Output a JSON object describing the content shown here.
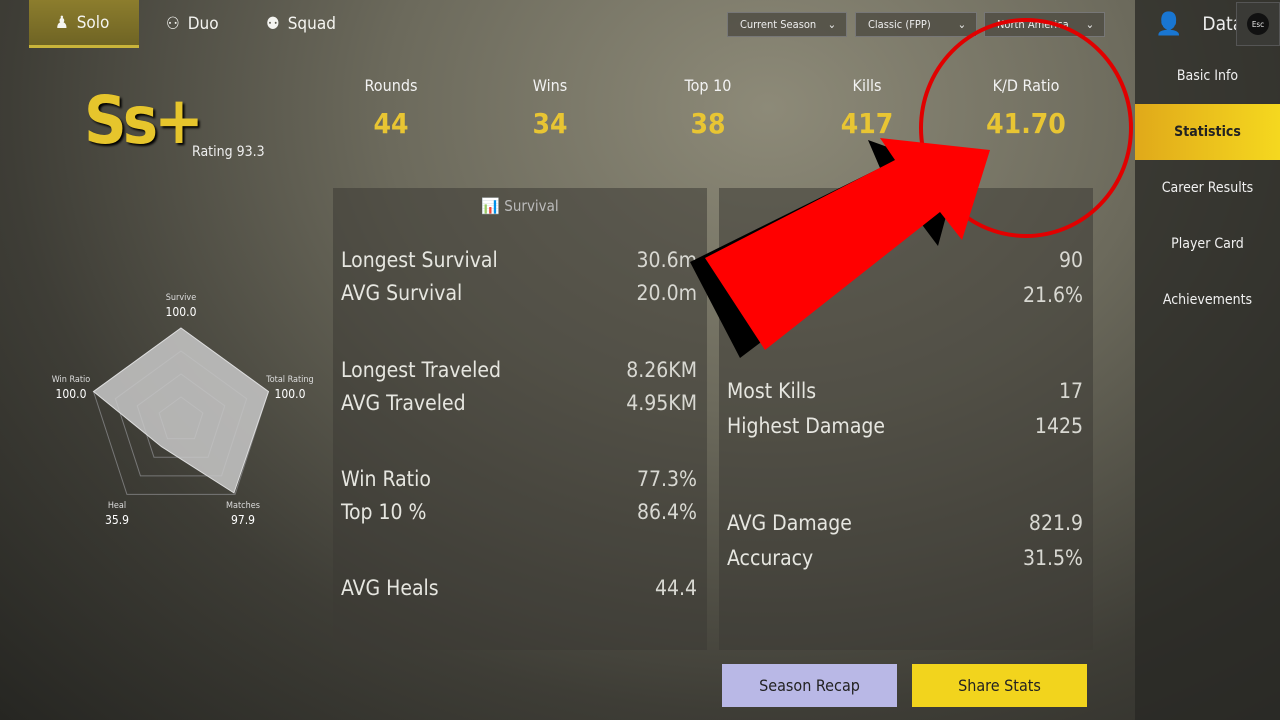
{
  "mode_tabs": [
    {
      "label": "Solo",
      "icon": "solo-icon",
      "active": true
    },
    {
      "label": "Duo",
      "icon": "duo-icon"
    },
    {
      "label": "Squad",
      "icon": "squad-icon"
    }
  ],
  "filters": [
    {
      "value": "Current Season"
    },
    {
      "value": "Classic (FPP)"
    },
    {
      "value": "North America"
    }
  ],
  "header": {
    "title": "Data",
    "esc_label": "Esc"
  },
  "sidebar": {
    "items": [
      {
        "label": "Basic Info"
      },
      {
        "label": "Statistics",
        "active": true
      },
      {
        "label": "Career Results"
      },
      {
        "label": "Player Card"
      },
      {
        "label": "Achievements"
      }
    ]
  },
  "tier": {
    "badge": "Ss+",
    "rating_label": "Rating 93.3"
  },
  "summary": [
    {
      "label": "Rounds",
      "value": "44"
    },
    {
      "label": "Wins",
      "value": "34"
    },
    {
      "label": "Top 10",
      "value": "38"
    },
    {
      "label": "Kills",
      "value": "417"
    },
    {
      "label": "K/D Ratio",
      "value": "41.70"
    }
  ],
  "radar": {
    "axes": [
      {
        "label": "Survive",
        "value": "100.0"
      },
      {
        "label": "Total Rating",
        "value": "100.0"
      },
      {
        "label": "Matches",
        "value": "97.9"
      },
      {
        "label": "Heal",
        "value": "35.9"
      },
      {
        "label": "Win Ratio",
        "value": "100.0"
      }
    ],
    "max": 100
  },
  "survival_panel": {
    "title": "Survival",
    "rows": [
      {
        "label": "Longest Survival",
        "value": "30.6m"
      },
      {
        "label": "AVG Survival",
        "value": "20.0m"
      },
      {
        "label": "Longest Traveled",
        "value": "8.26KM"
      },
      {
        "label": "AVG Traveled",
        "value": "4.95KM"
      },
      {
        "label": "Win Ratio",
        "value": "77.3%"
      },
      {
        "label": "Top 10 %",
        "value": "86.4%"
      },
      {
        "label": "AVG Heals",
        "value": "44.4"
      }
    ]
  },
  "combat_panel": {
    "rows": [
      {
        "label": "",
        "value": "90"
      },
      {
        "label": "",
        "value": "21.6%"
      },
      {
        "label": "Most Kills",
        "value": "17"
      },
      {
        "label": "Highest Damage",
        "value": "1425"
      },
      {
        "label": "AVG Damage",
        "value": "821.9"
      },
      {
        "label": "Accuracy",
        "value": "31.5%"
      }
    ]
  },
  "buttons": {
    "season_recap": "Season Recap",
    "share_stats": "Share Stats"
  },
  "colors": {
    "accent_yellow": "#e8c533",
    "annotation_red": "#e10000",
    "recap_button": "#b9b8e6",
    "share_button": "#f2d41d"
  }
}
